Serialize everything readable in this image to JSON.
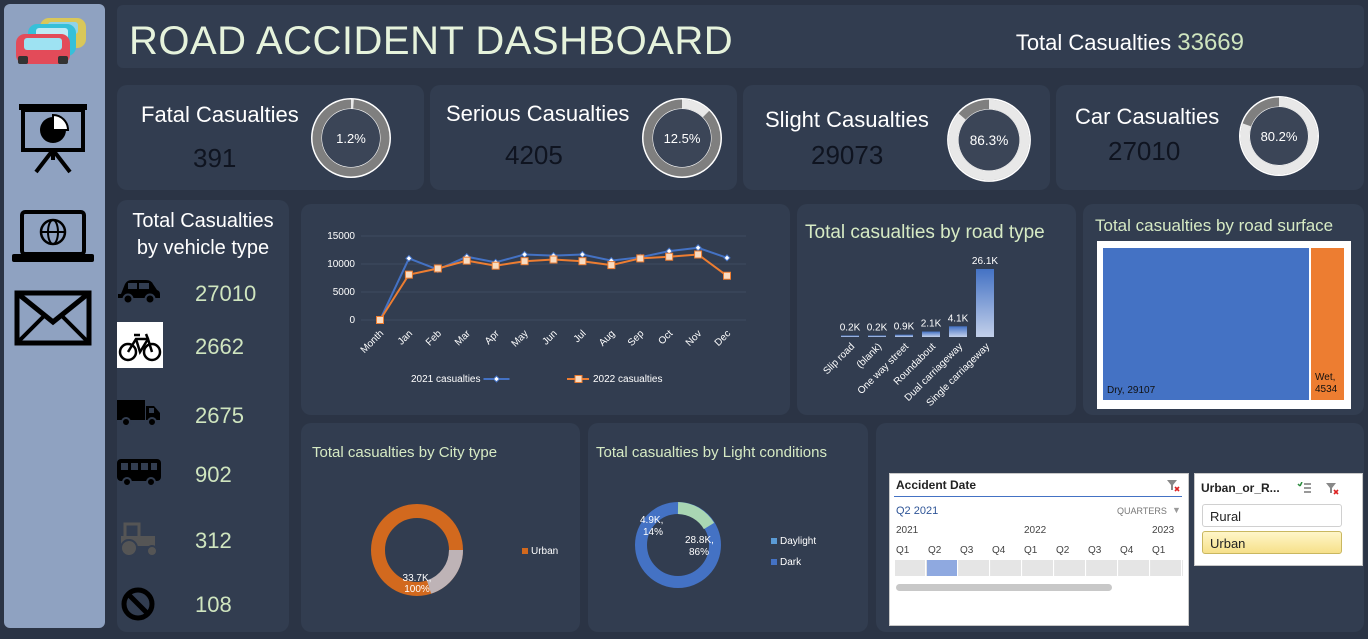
{
  "header": {
    "title": "ROAD ACCIDENT DASHBOARD",
    "total_label": "Total Casualties",
    "total_value": "33669"
  },
  "sidebar": {
    "icons": [
      "cars-icon",
      "presentation-chart-icon",
      "laptop-globe-icon",
      "mail-icon"
    ]
  },
  "kpis": [
    {
      "label": "Fatal Casualties",
      "value": "391",
      "percent_text": "1.2%",
      "percent": 1.2
    },
    {
      "label": "Serious Casualties",
      "value": "4205",
      "percent_text": "12.5%",
      "percent": 12.5
    },
    {
      "label": "Slight Casualties",
      "value": "29073",
      "percent_text": "86.3%",
      "percent": 86.3
    },
    {
      "label": "Car Casualties",
      "value": "27010",
      "percent_text": "80.2%",
      "percent": 80.2
    }
  ],
  "vehicle_type": {
    "title_line1": "Total Casualties",
    "title_line2": "by vehicle type",
    "rows": [
      {
        "icon": "car-icon",
        "value": "27010"
      },
      {
        "icon": "bicycle-icon",
        "value": "2662"
      },
      {
        "icon": "truck-icon",
        "value": "2675"
      },
      {
        "icon": "bus-icon",
        "value": "902"
      },
      {
        "icon": "tractor-icon",
        "value": "312"
      },
      {
        "icon": "no-entry-icon",
        "value": "108"
      }
    ]
  },
  "colors": {
    "series_2021": "#4472c4",
    "series_2022": "#ed7d31",
    "ring_fill": "#7f7f7f",
    "ring_track": "#e8e8e8",
    "accent_green": "#cfe5bf"
  },
  "chart_data": [
    {
      "type": "line",
      "title": "",
      "categories": [
        "Month",
        "Jan",
        "Feb",
        "Mar",
        "Apr",
        "May",
        "Jun",
        "Jul",
        "Aug",
        "Sep",
        "Oct",
        "Nov",
        "Dec"
      ],
      "series": [
        {
          "name": "2021 casualties",
          "values": [
            0,
            11000,
            9000,
            11300,
            10300,
            11700,
            11500,
            11700,
            10600,
            11200,
            12300,
            12900,
            11100
          ]
        },
        {
          "name": "2022 casualties",
          "values": [
            0,
            8100,
            9200,
            10600,
            9700,
            10500,
            10800,
            10500,
            9800,
            11000,
            11300,
            11700,
            7900
          ]
        }
      ],
      "yticks": [
        "15000",
        "10000",
        "5000",
        "0"
      ],
      "ylim": [
        0,
        15000
      ]
    },
    {
      "type": "bar",
      "title": "Total casualties by road type",
      "categories": [
        "Slip road",
        "(blank)",
        "One way street",
        "Roundabout",
        "Dual carriageway",
        "Single carriageway"
      ],
      "values": [
        0.2,
        0.2,
        0.9,
        2.1,
        4.1,
        26.1
      ],
      "labels": [
        "0.2K",
        "0.2K",
        "0.9K",
        "2.1K",
        "4.1K",
        "26.1K"
      ],
      "unit": "K"
    },
    {
      "type": "treemap",
      "title": "Total casualties by road surface",
      "items": [
        {
          "label": "Dry, 29107",
          "value": 29107
        },
        {
          "label_line1": "Wet,",
          "label_line2": "4534",
          "value": 4534
        }
      ]
    },
    {
      "type": "pie",
      "title": "Total casualties by City type",
      "slices": [
        {
          "name": "Urban",
          "value": 33.7,
          "label_line1": "33.7K,",
          "label_line2": "100%"
        }
      ]
    },
    {
      "type": "pie",
      "title": "Total casualties by Light conditions",
      "slices": [
        {
          "name": "Daylight",
          "value": 28.8,
          "label_line1": "28.8K,",
          "label_line2": "86%"
        },
        {
          "name": "Dark",
          "value": 4.9,
          "label_line1": "4.9K,",
          "label_line2": "14%"
        }
      ]
    }
  ],
  "date_slicer": {
    "title": "Accident Date",
    "selected": "Q2 2021",
    "period": "QUARTERS",
    "years": [
      "2021",
      "2022",
      "2023"
    ],
    "quarters": [
      "Q1",
      "Q2",
      "Q3",
      "Q4",
      "Q1",
      "Q2",
      "Q3",
      "Q4",
      "Q1"
    ],
    "selected_quarter": 1
  },
  "area_slicer": {
    "title": "Urban_or_R...",
    "items": [
      "Rural",
      "Urban"
    ],
    "selected": "Urban"
  }
}
